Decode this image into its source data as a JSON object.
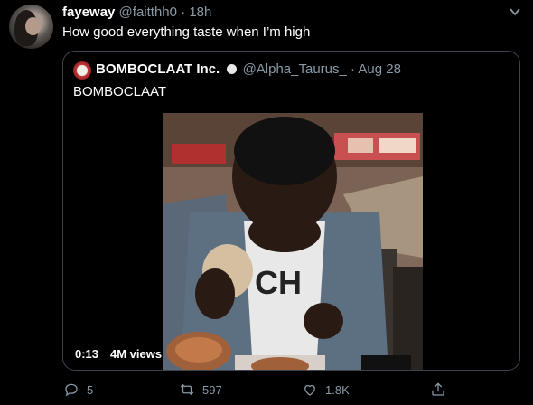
{
  "tweet": {
    "display_name": "fayeway",
    "handle": "@faitthh0",
    "separator": "·",
    "time": "18h",
    "text": "How good everything taste when I’m high"
  },
  "quoted": {
    "display_name": "BOMBOCLAAT Inc.",
    "handle": "@Alpha_Taurus_",
    "separator": "·",
    "date": "Aug 28",
    "text": "BOMBOCLAAT",
    "video": {
      "duration": "0:13",
      "views": "4M views",
      "shirt_text": "CH"
    }
  },
  "actions": {
    "replies": "5",
    "retweets": "597",
    "likes": "1.8K"
  },
  "icons": [
    "caret-down-icon",
    "verified-dot-icon",
    "reply-icon",
    "retweet-icon",
    "like-icon",
    "share-icon"
  ],
  "colors": {
    "background": "#000000",
    "secondary_text": "#8899a6",
    "border": "#3d4450"
  }
}
